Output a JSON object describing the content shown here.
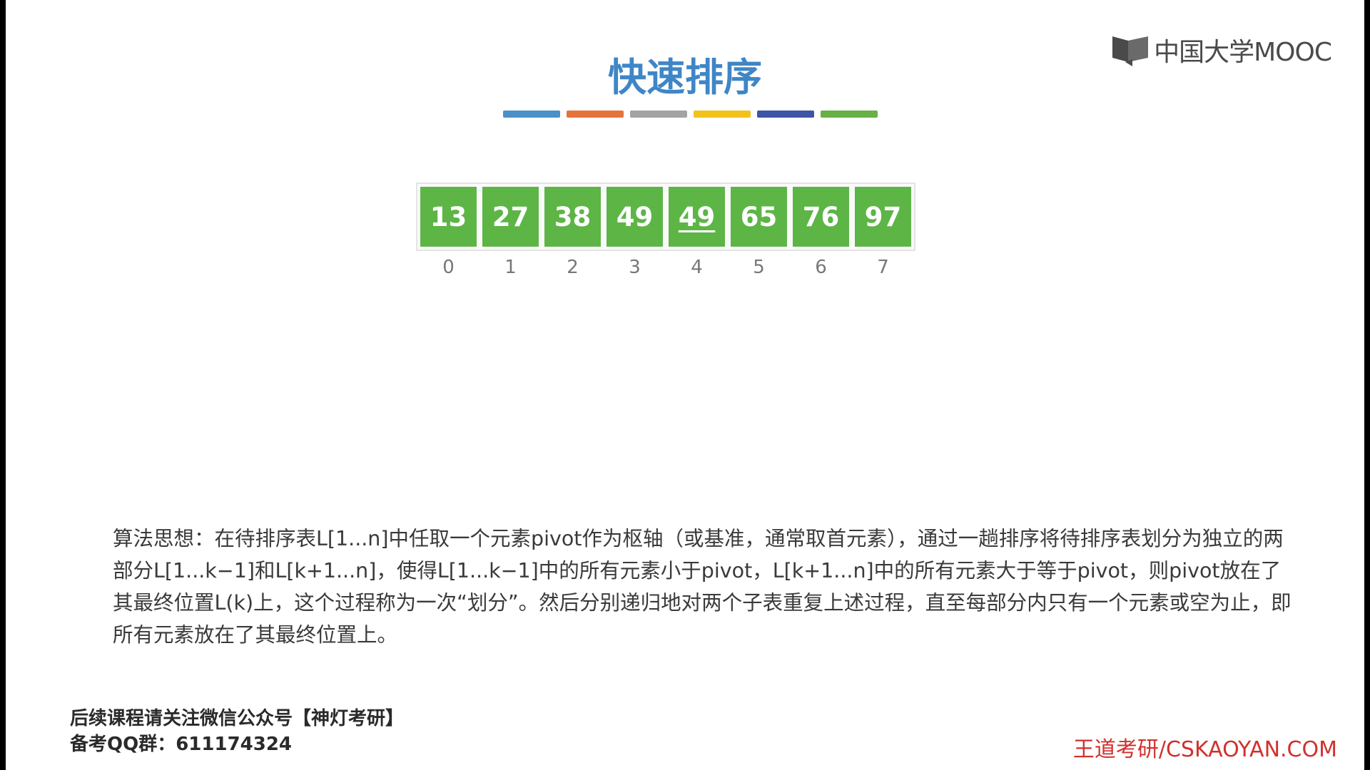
{
  "logo": {
    "text": "中国大学MOOC",
    "icon": "mooc-logo-icon"
  },
  "title": "快速排序",
  "color_bar": [
    "#4a90c9",
    "#e5743a",
    "#a3a3a3",
    "#f2c21b",
    "#3d55a6",
    "#68b146"
  ],
  "array": {
    "values": [
      "13",
      "27",
      "38",
      "49",
      "49",
      "65",
      "76",
      "97"
    ],
    "indices": [
      "0",
      "1",
      "2",
      "3",
      "4",
      "5",
      "6",
      "7"
    ],
    "cell_color": "#5db546",
    "underlined_index": 4
  },
  "description": "算法思想：在待排序表L[1...n]中任取一个元素pivot作为枢轴（或基准，通常取首元素），通过一趟排序将待排序表划分为独立的两部分L[1...k−1]和L[k+1...n]，使得L[1...k−1]中的所有元素小于pivot，L[k+1...n]中的所有元素大于等于pivot，则pivot放在了其最终位置L(k)上，这个过程称为一次“划分”。然后分别递归地对两个子表重复上述过程，直至每部分内只有一个元素或空为止，即所有元素放在了其最终位置上。",
  "footer": {
    "line1": "后续课程请关注微信公众号【神灯考研】",
    "line2": "备考QQ群：611174324",
    "right": "王道考研/CSKAOYAN.COM",
    "right_color": "#d0312d"
  }
}
